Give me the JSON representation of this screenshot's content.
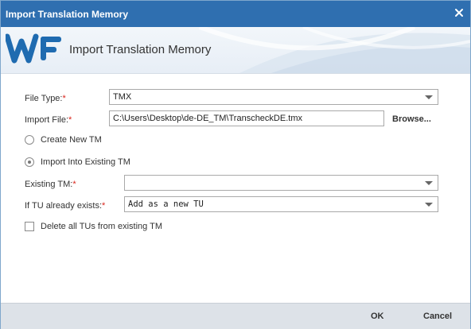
{
  "window": {
    "title": "Import Translation Memory"
  },
  "banner": {
    "heading": "Import Translation Memory",
    "logo_icon": "wf-logo"
  },
  "colors": {
    "titlebar": "#2f6fb0",
    "required": "#d9251c",
    "footer": "#dde2e8"
  },
  "form": {
    "file_type": {
      "label": "File Type:",
      "required": "*",
      "value": "TMX"
    },
    "import_file": {
      "label": "Import File:",
      "required": "*",
      "value": "C:\\Users\\Desktop\\de-DE_TM\\TranscheckDE.tmx",
      "browse_label": "Browse..."
    },
    "create_new_tm": {
      "label": "Create New TM",
      "checked": false
    },
    "import_existing_tm": {
      "label": "Import Into Existing TM",
      "checked": true
    },
    "existing_tm": {
      "label": "Existing TM:",
      "required": "*",
      "value": ""
    },
    "if_tu_exists": {
      "label": "If TU already exists:",
      "required": "*",
      "value": "Add as a new TU"
    },
    "delete_all_tus": {
      "label": "Delete all TUs from existing TM",
      "checked": false
    }
  },
  "footer": {
    "ok_label": "OK",
    "cancel_label": "Cancel"
  }
}
